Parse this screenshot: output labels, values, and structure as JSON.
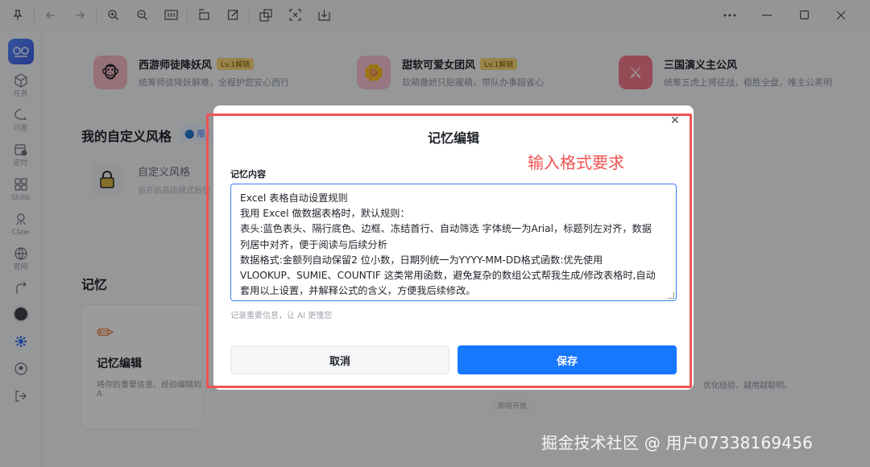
{
  "toolbar": {
    "left_icons": [
      "pin-icon",
      "back-arrow-icon",
      "forward-arrow-icon",
      "zoom-in-icon",
      "zoom-out-icon",
      "fit-width-icon",
      "rotate-icon",
      "edit-icon",
      "extract-icon",
      "scan-icon",
      "download-icon"
    ],
    "right_icons": [
      "more-icon",
      "minimize-icon",
      "maximize-icon",
      "close-icon"
    ]
  },
  "sidebar": {
    "items": [
      {
        "icon": "cube-icon",
        "label": "任务"
      },
      {
        "icon": "chat-icon",
        "label": "问答"
      },
      {
        "icon": "calendar-clock-icon",
        "label": "定时"
      },
      {
        "icon": "grid-icon",
        "label": "Skills"
      },
      {
        "icon": "claw-icon",
        "label": "Claw"
      },
      {
        "icon": "globe-icon",
        "label": "官网"
      }
    ],
    "bottom_icons": [
      "share-icon",
      "gear-icon",
      "user-icon",
      "logout-icon"
    ]
  },
  "main": {
    "styles": [
      {
        "name": "西游师徒降妖风",
        "badge": "Lv.1解锁",
        "desc": "统筹师徒降妖解难，全程护您安心西行",
        "color": "#f2b7c2",
        "glyph": "🐵"
      },
      {
        "name": "甜软可爱女团风",
        "badge": "Lv.1解锁",
        "desc": "软萌撒娇只贴暖萌，带队办事超省心",
        "color": "#f6c0d3",
        "glyph": "🌼"
      },
      {
        "name": "三国演义主公风",
        "badge": "",
        "desc": "统筹五虎上将征战，稳胜全盘，唯主公英明",
        "color": "#f07a8a",
        "glyph": "⚔"
      }
    ],
    "custom_section_title": "我的自定义风格",
    "custom_chip": "🔵 限",
    "custom_card": {
      "name": "自定义风格",
      "desc": "自开启高级模式后使"
    },
    "memory_section_title": "记忆",
    "memory_card": {
      "title": "记忆编辑",
      "desc": "将你的重要信息、经验编辑到 A"
    },
    "right_hint": "优化经验，越用越聪明。",
    "mini_button": "即将开放"
  },
  "dialog": {
    "title": "记忆编辑",
    "annotation": "输入格式要求",
    "field_label": "记忆内容",
    "content_lines": [
      "Excel 表格自动设置规则",
      "我用 Excel 做数据表格时，默认规则：",
      "表头:蓝色表头、隔行底色、边框、冻结首行、自动筛选 字体统一为Arial，标题列左对齐，数据",
      "列居中对齐，便于阅读与后续分析",
      "数据格式:金额列自动保留2 位小数，日期列统一为YYYY-MM-DD格式函数:优先使用",
      "VLOOKUP、SUMIE、COUNTIF 这类常用函数，避免复杂的数组公式帮我生成/修改表格时,自动",
      "套用以上设置，并解释公式的含义，方便我后续修改。"
    ],
    "hint": "记录重要信息，让 AI 更懂您",
    "cancel_label": "取消",
    "save_label": "保存"
  },
  "watermark": "掘金技术社区 @ 用户07338169456"
}
